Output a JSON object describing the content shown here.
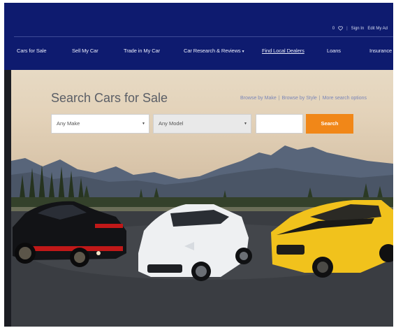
{
  "header": {
    "cart_count": "0",
    "sign_in": "Sign In",
    "edit_my_ad": "Edit My Ad",
    "separator": "|"
  },
  "nav": {
    "items": [
      {
        "label": "Cars for Sale"
      },
      {
        "label": "Sell My Car"
      },
      {
        "label": "Trade in My Car"
      },
      {
        "label": "Car Research & Reviews"
      },
      {
        "label": "Find Local Dealers"
      },
      {
        "label": "Loans"
      },
      {
        "label": "Insurance"
      }
    ]
  },
  "search": {
    "title": "Search Cars for Sale",
    "make_value": "Any Make",
    "model_value": "Any Model",
    "zip_value": "",
    "button_label": "Search",
    "links": [
      {
        "label": "Browse by Make"
      },
      {
        "label": "Browse by Style"
      },
      {
        "label": "More search options"
      }
    ],
    "link_separator": "|"
  },
  "colors": {
    "header_blue": "#0e1b6f",
    "search_orange": "#f18718",
    "link_blue": "#7a86b8"
  }
}
